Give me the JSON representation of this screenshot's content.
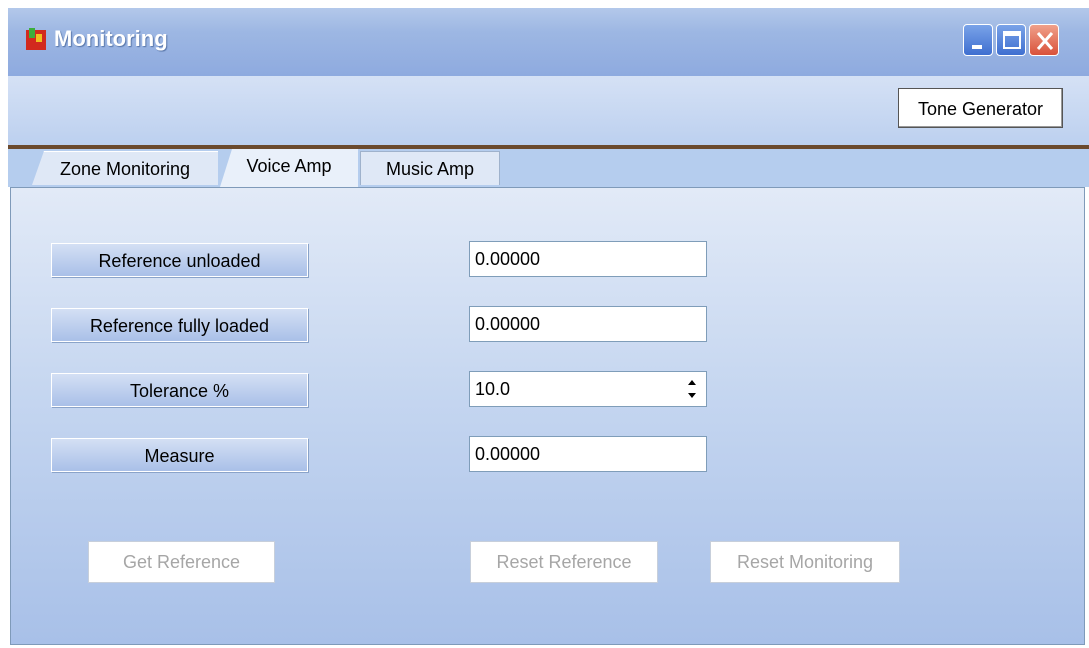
{
  "window": {
    "title": "Monitoring"
  },
  "toolbar": {
    "tone_generator_label": "Tone Generator"
  },
  "tabs": [
    {
      "label": "Zone Monitoring",
      "active": false
    },
    {
      "label": "Voice Amp",
      "active": true
    },
    {
      "label": "Music Amp",
      "active": false
    }
  ],
  "fields": {
    "reference_unloaded": {
      "label": "Reference unloaded",
      "value": "0.00000"
    },
    "reference_fully_loaded": {
      "label": "Reference fully loaded",
      "value": "0.00000"
    },
    "tolerance": {
      "label": "Tolerance %",
      "value": "10.0"
    },
    "measure": {
      "label": "Measure",
      "value": "0.00000"
    }
  },
  "buttons": {
    "get_reference": "Get Reference",
    "reset_reference": "Reset Reference",
    "reset_monitoring": "Reset Monitoring"
  },
  "icons": [
    "app-icon",
    "minimize-icon",
    "maximize-icon",
    "close-icon",
    "spin-up-icon",
    "spin-down-icon"
  ],
  "colors": {
    "titlebar": "#8eaadf",
    "tab_divider": "#6b4a2e",
    "disabled_text": "#a6a6a6"
  }
}
